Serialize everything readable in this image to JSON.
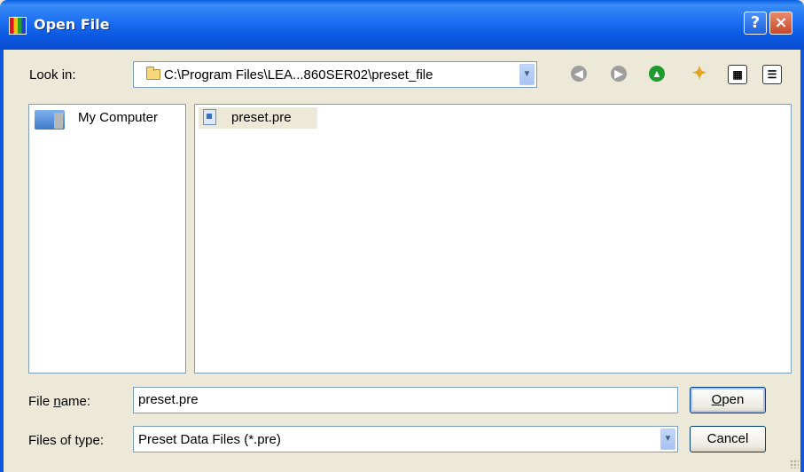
{
  "window": {
    "title": "Open File",
    "help_label": "?",
    "close_label": "×"
  },
  "toolbar": {
    "look_in_label": "Look in:",
    "look_in_path": "C:\\Program Files\\LEA...860SER02\\preset_file",
    "back_icon": "back-arrow-icon",
    "forward_icon": "forward-arrow-icon",
    "up_icon": "up-folder-icon",
    "new_folder_icon": "new-folder-icon",
    "view_list_icon": "list-view-icon",
    "view_details_icon": "details-view-icon"
  },
  "places": {
    "items": [
      {
        "label": "My Computer",
        "icon": "computer-icon"
      }
    ]
  },
  "files": [
    {
      "name": "preset.pre",
      "icon": "preset-file-icon",
      "selected": true
    }
  ],
  "form": {
    "file_name_label": "File name:",
    "file_name_value": "preset.pre",
    "file_type_label": "Files of type:",
    "file_type_value": "Preset Data Files (*.pre)",
    "open_label": "Open",
    "cancel_label": "Cancel"
  },
  "colors": {
    "titlebar": "#0b57e0",
    "dialog_bg": "#ece9d8",
    "border": "#7f9db9"
  }
}
